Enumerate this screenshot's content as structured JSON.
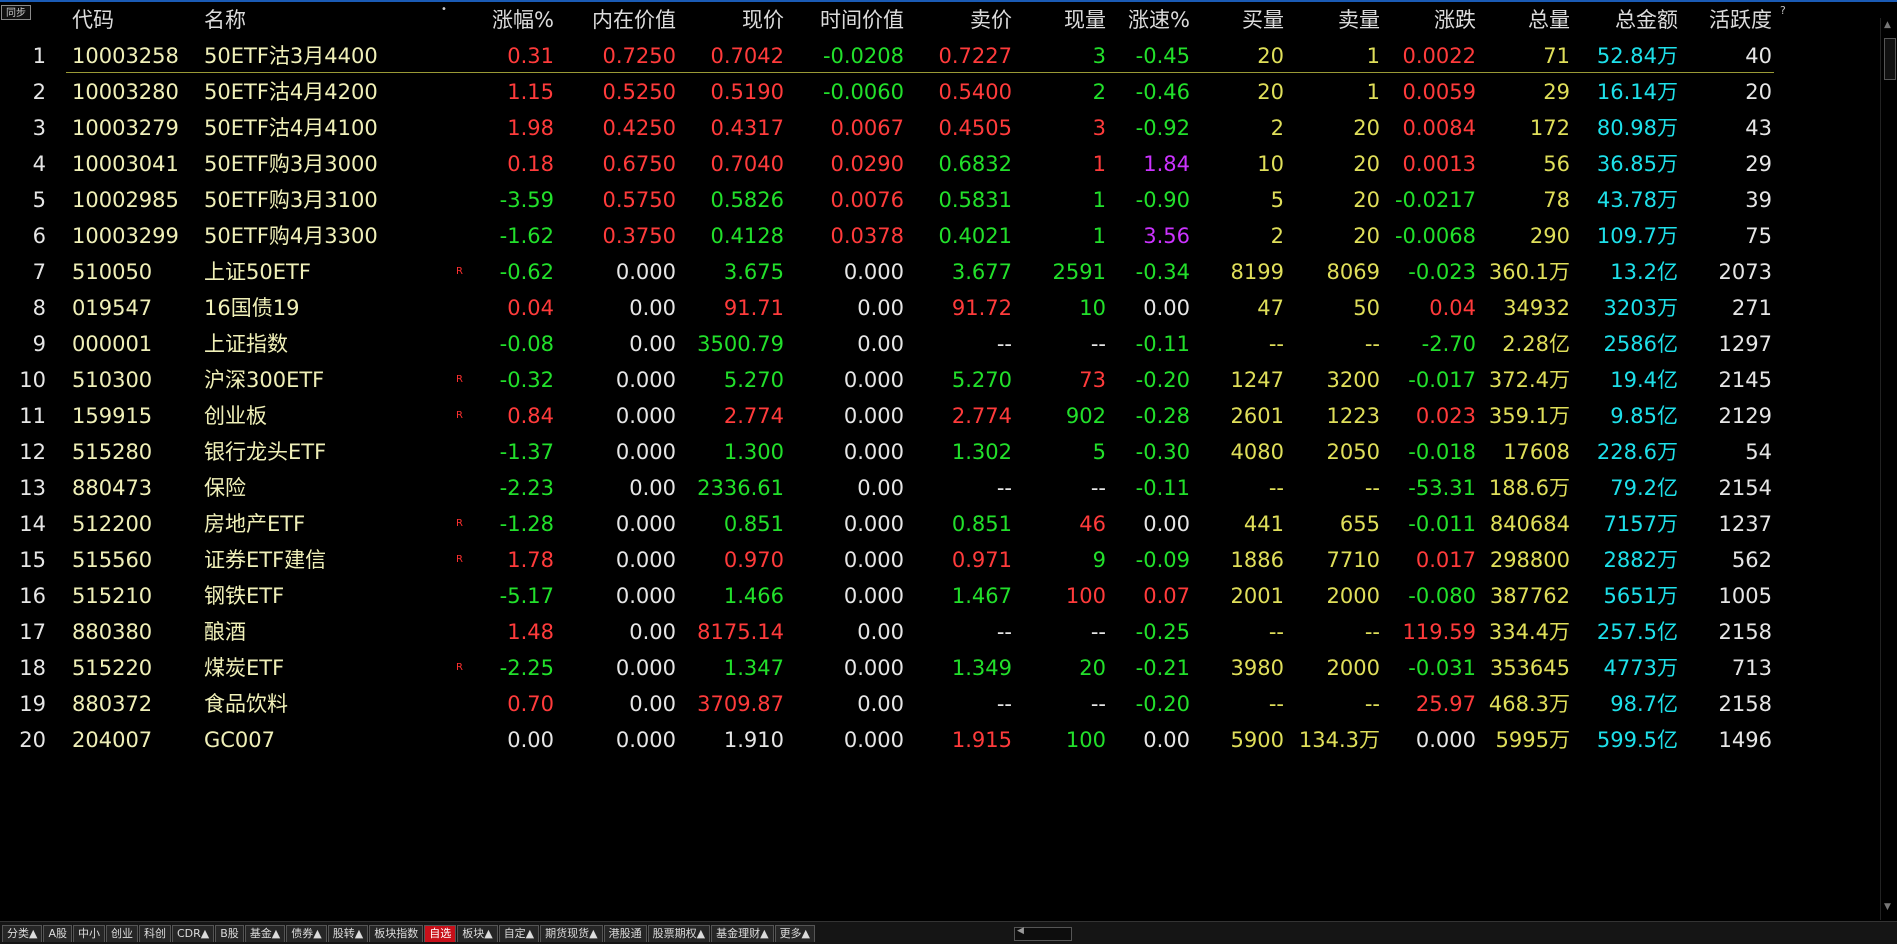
{
  "toolbar": {
    "sync_label": "同步",
    "help_mark": "?",
    "sort_indicator": "•"
  },
  "columns": {
    "idx": "",
    "code": "代码",
    "name": "名称",
    "pct": "涨幅%",
    "intrinsic": "内在价值",
    "price": "现价",
    "timeval": "时间价值",
    "ask": "卖价",
    "vol": "现量",
    "speed": "涨速%",
    "bidvol": "买量",
    "askvol": "卖量",
    "change": "涨跌",
    "total": "总量",
    "amount": "总金额",
    "activity": "活跃度"
  },
  "rows": [
    {
      "idx": "1",
      "code": "10003258",
      "name": "50ETF沽3月4400",
      "flag": "",
      "pct": "0.31",
      "intrinsic": "0.7250",
      "price": "0.7042",
      "timeval": "-0.0208",
      "ask": "0.7227",
      "vol": "3",
      "speed": "-0.45",
      "bidvol": "20",
      "askvol": "1",
      "change": "0.0022",
      "total": "71",
      "amount": "52.84万",
      "activity": "40",
      "colors": {
        "pct": "red",
        "intrinsic": "red",
        "price": "red",
        "timeval": "green",
        "ask": "red",
        "vol": "green",
        "speed": "green",
        "change": "red"
      }
    },
    {
      "idx": "2",
      "code": "10003280",
      "name": "50ETF沽4月4200",
      "flag": "",
      "pct": "1.15",
      "intrinsic": "0.5250",
      "price": "0.5190",
      "timeval": "-0.0060",
      "ask": "0.5400",
      "vol": "2",
      "speed": "-0.46",
      "bidvol": "20",
      "askvol": "1",
      "change": "0.0059",
      "total": "29",
      "amount": "16.14万",
      "activity": "20",
      "colors": {
        "pct": "red",
        "intrinsic": "red",
        "price": "red",
        "timeval": "green",
        "ask": "red",
        "vol": "green",
        "speed": "green",
        "change": "red"
      }
    },
    {
      "idx": "3",
      "code": "10003279",
      "name": "50ETF沽4月4100",
      "flag": "",
      "pct": "1.98",
      "intrinsic": "0.4250",
      "price": "0.4317",
      "timeval": "0.0067",
      "ask": "0.4505",
      "vol": "3",
      "speed": "-0.92",
      "bidvol": "2",
      "askvol": "20",
      "change": "0.0084",
      "total": "172",
      "amount": "80.98万",
      "activity": "43",
      "colors": {
        "pct": "red",
        "intrinsic": "red",
        "price": "red",
        "timeval": "red",
        "ask": "red",
        "vol": "red",
        "speed": "green",
        "change": "red"
      }
    },
    {
      "idx": "4",
      "code": "10003041",
      "name": "50ETF购3月3000",
      "flag": "",
      "pct": "0.18",
      "intrinsic": "0.6750",
      "price": "0.7040",
      "timeval": "0.0290",
      "ask": "0.6832",
      "vol": "1",
      "speed": "1.84",
      "bidvol": "10",
      "askvol": "20",
      "change": "0.0013",
      "total": "56",
      "amount": "36.85万",
      "activity": "29",
      "colors": {
        "pct": "red",
        "intrinsic": "red",
        "price": "red",
        "timeval": "red",
        "ask": "green",
        "vol": "red",
        "speed": "purple",
        "change": "red"
      }
    },
    {
      "idx": "5",
      "code": "10002985",
      "name": "50ETF购3月3100",
      "flag": "",
      "pct": "-3.59",
      "intrinsic": "0.5750",
      "price": "0.5826",
      "timeval": "0.0076",
      "ask": "0.5831",
      "vol": "1",
      "speed": "-0.90",
      "bidvol": "5",
      "askvol": "20",
      "change": "-0.0217",
      "total": "78",
      "amount": "43.78万",
      "activity": "39",
      "colors": {
        "pct": "green",
        "intrinsic": "red",
        "price": "green",
        "timeval": "red",
        "ask": "green",
        "vol": "green",
        "speed": "green",
        "change": "green"
      }
    },
    {
      "idx": "6",
      "code": "10003299",
      "name": "50ETF购4月3300",
      "flag": "",
      "pct": "-1.62",
      "intrinsic": "0.3750",
      "price": "0.4128",
      "timeval": "0.0378",
      "ask": "0.4021",
      "vol": "1",
      "speed": "3.56",
      "bidvol": "2",
      "askvol": "20",
      "change": "-0.0068",
      "total": "290",
      "amount": "109.7万",
      "activity": "75",
      "colors": {
        "pct": "green",
        "intrinsic": "red",
        "price": "green",
        "timeval": "red",
        "ask": "green",
        "vol": "green",
        "speed": "purple",
        "change": "green"
      }
    },
    {
      "idx": "7",
      "code": "510050",
      "name": "上证50ETF",
      "flag": "R",
      "pct": "-0.62",
      "intrinsic": "0.000",
      "price": "3.675",
      "timeval": "0.000",
      "ask": "3.677",
      "vol": "2591",
      "speed": "-0.34",
      "bidvol": "8199",
      "askvol": "8069",
      "change": "-0.023",
      "total": "360.1万",
      "amount": "13.2亿",
      "activity": "2073",
      "colors": {
        "pct": "green",
        "intrinsic": "white",
        "price": "green",
        "timeval": "white",
        "ask": "green",
        "vol": "green",
        "speed": "green",
        "change": "green"
      }
    },
    {
      "idx": "8",
      "code": "019547",
      "name": "16国债19",
      "flag": "",
      "pct": "0.04",
      "intrinsic": "0.00",
      "price": "91.71",
      "timeval": "0.00",
      "ask": "91.72",
      "vol": "10",
      "speed": "0.00",
      "bidvol": "47",
      "askvol": "50",
      "change": "0.04",
      "total": "34932",
      "amount": "3203万",
      "activity": "271",
      "colors": {
        "pct": "red",
        "intrinsic": "white",
        "price": "red",
        "timeval": "white",
        "ask": "red",
        "vol": "green",
        "speed": "white",
        "change": "red"
      }
    },
    {
      "idx": "9",
      "code": "000001",
      "name": "上证指数",
      "flag": "",
      "pct": "-0.08",
      "intrinsic": "0.00",
      "price": "3500.79",
      "timeval": "0.00",
      "ask": "--",
      "vol": "--",
      "speed": "-0.11",
      "bidvol": "--",
      "askvol": "--",
      "change": "-2.70",
      "total": "2.28亿",
      "amount": "2586亿",
      "activity": "1297",
      "colors": {
        "pct": "green",
        "intrinsic": "white",
        "price": "green",
        "timeval": "white",
        "ask": "white",
        "vol": "white",
        "speed": "green",
        "change": "green"
      }
    },
    {
      "idx": "10",
      "code": "510300",
      "name": "沪深300ETF",
      "flag": "R",
      "pct": "-0.32",
      "intrinsic": "0.000",
      "price": "5.270",
      "timeval": "0.000",
      "ask": "5.270",
      "vol": "73",
      "speed": "-0.20",
      "bidvol": "1247",
      "askvol": "3200",
      "change": "-0.017",
      "total": "372.4万",
      "amount": "19.4亿",
      "activity": "2145",
      "colors": {
        "pct": "green",
        "intrinsic": "white",
        "price": "green",
        "timeval": "white",
        "ask": "green",
        "vol": "red",
        "speed": "green",
        "change": "green"
      }
    },
    {
      "idx": "11",
      "code": "159915",
      "name": "创业板",
      "flag": "R",
      "pct": "0.84",
      "intrinsic": "0.000",
      "price": "2.774",
      "timeval": "0.000",
      "ask": "2.774",
      "vol": "902",
      "speed": "-0.28",
      "bidvol": "2601",
      "askvol": "1223",
      "change": "0.023",
      "total": "359.1万",
      "amount": "9.85亿",
      "activity": "2129",
      "colors": {
        "pct": "red",
        "intrinsic": "white",
        "price": "red",
        "timeval": "white",
        "ask": "red",
        "vol": "green",
        "speed": "green",
        "change": "red"
      }
    },
    {
      "idx": "12",
      "code": "515280",
      "name": "银行龙头ETF",
      "flag": "",
      "pct": "-1.37",
      "intrinsic": "0.000",
      "price": "1.300",
      "timeval": "0.000",
      "ask": "1.302",
      "vol": "5",
      "speed": "-0.30",
      "bidvol": "4080",
      "askvol": "2050",
      "change": "-0.018",
      "total": "17608",
      "amount": "228.6万",
      "activity": "54",
      "colors": {
        "pct": "green",
        "intrinsic": "white",
        "price": "green",
        "timeval": "white",
        "ask": "green",
        "vol": "green",
        "speed": "green",
        "change": "green"
      }
    },
    {
      "idx": "13",
      "code": "880473",
      "name": "保险",
      "flag": "",
      "pct": "-2.23",
      "intrinsic": "0.00",
      "price": "2336.61",
      "timeval": "0.00",
      "ask": "--",
      "vol": "--",
      "speed": "-0.11",
      "bidvol": "--",
      "askvol": "--",
      "change": "-53.31",
      "total": "188.6万",
      "amount": "79.2亿",
      "activity": "2154",
      "colors": {
        "pct": "green",
        "intrinsic": "white",
        "price": "green",
        "timeval": "white",
        "ask": "white",
        "vol": "white",
        "speed": "green",
        "change": "green"
      }
    },
    {
      "idx": "14",
      "code": "512200",
      "name": "房地产ETF",
      "flag": "R",
      "pct": "-1.28",
      "intrinsic": "0.000",
      "price": "0.851",
      "timeval": "0.000",
      "ask": "0.851",
      "vol": "46",
      "speed": "0.00",
      "bidvol": "441",
      "askvol": "655",
      "change": "-0.011",
      "total": "840684",
      "amount": "7157万",
      "activity": "1237",
      "colors": {
        "pct": "green",
        "intrinsic": "white",
        "price": "green",
        "timeval": "white",
        "ask": "green",
        "vol": "red",
        "speed": "white",
        "change": "green"
      }
    },
    {
      "idx": "15",
      "code": "515560",
      "name": "证券ETF建信",
      "flag": "R",
      "pct": "1.78",
      "intrinsic": "0.000",
      "price": "0.970",
      "timeval": "0.000",
      "ask": "0.971",
      "vol": "9",
      "speed": "-0.09",
      "bidvol": "1886",
      "askvol": "7710",
      "change": "0.017",
      "total": "298800",
      "amount": "2882万",
      "activity": "562",
      "colors": {
        "pct": "red",
        "intrinsic": "white",
        "price": "red",
        "timeval": "white",
        "ask": "red",
        "vol": "green",
        "speed": "green",
        "change": "red"
      }
    },
    {
      "idx": "16",
      "code": "515210",
      "name": "钢铁ETF",
      "flag": "",
      "pct": "-5.17",
      "intrinsic": "0.000",
      "price": "1.466",
      "timeval": "0.000",
      "ask": "1.467",
      "vol": "100",
      "speed": "0.07",
      "bidvol": "2001",
      "askvol": "2000",
      "change": "-0.080",
      "total": "387762",
      "amount": "5651万",
      "activity": "1005",
      "colors": {
        "pct": "green",
        "intrinsic": "white",
        "price": "green",
        "timeval": "white",
        "ask": "green",
        "vol": "red",
        "speed": "red",
        "change": "green"
      }
    },
    {
      "idx": "17",
      "code": "880380",
      "name": "酿酒",
      "flag": "",
      "pct": "1.48",
      "intrinsic": "0.00",
      "price": "8175.14",
      "timeval": "0.00",
      "ask": "--",
      "vol": "--",
      "speed": "-0.25",
      "bidvol": "--",
      "askvol": "--",
      "change": "119.59",
      "total": "334.4万",
      "amount": "257.5亿",
      "activity": "2158",
      "colors": {
        "pct": "red",
        "intrinsic": "white",
        "price": "red",
        "timeval": "white",
        "ask": "white",
        "vol": "white",
        "speed": "green",
        "change": "red"
      }
    },
    {
      "idx": "18",
      "code": "515220",
      "name": "煤炭ETF",
      "flag": "R",
      "pct": "-2.25",
      "intrinsic": "0.000",
      "price": "1.347",
      "timeval": "0.000",
      "ask": "1.349",
      "vol": "20",
      "speed": "-0.21",
      "bidvol": "3980",
      "askvol": "2000",
      "change": "-0.031",
      "total": "353645",
      "amount": "4773万",
      "activity": "713",
      "colors": {
        "pct": "green",
        "intrinsic": "white",
        "price": "green",
        "timeval": "white",
        "ask": "green",
        "vol": "green",
        "speed": "green",
        "change": "green"
      }
    },
    {
      "idx": "19",
      "code": "880372",
      "name": "食品饮料",
      "flag": "",
      "pct": "0.70",
      "intrinsic": "0.00",
      "price": "3709.87",
      "timeval": "0.00",
      "ask": "--",
      "vol": "--",
      "speed": "-0.20",
      "bidvol": "--",
      "askvol": "--",
      "change": "25.97",
      "total": "468.3万",
      "amount": "98.7亿",
      "activity": "2158",
      "colors": {
        "pct": "red",
        "intrinsic": "white",
        "price": "red",
        "timeval": "white",
        "ask": "white",
        "vol": "white",
        "speed": "green",
        "change": "red"
      }
    },
    {
      "idx": "20",
      "code": "204007",
      "name": "GC007",
      "flag": "",
      "pct": "0.00",
      "intrinsic": "0.000",
      "price": "1.910",
      "timeval": "0.000",
      "ask": "1.915",
      "vol": "100",
      "speed": "0.00",
      "bidvol": "5900",
      "askvol": "134.3万",
      "change": "0.000",
      "total": "5995万",
      "amount": "599.5亿",
      "activity": "1496",
      "colors": {
        "pct": "white",
        "intrinsic": "white",
        "price": "white",
        "timeval": "white",
        "ask": "red",
        "vol": "green",
        "speed": "white",
        "change": "white"
      }
    }
  ],
  "tabs": [
    {
      "label": "分类▲",
      "active": false
    },
    {
      "label": "A股",
      "active": false
    },
    {
      "label": "中小",
      "active": false
    },
    {
      "label": "创业",
      "active": false
    },
    {
      "label": "科创",
      "active": false
    },
    {
      "label": "CDR▲",
      "active": false
    },
    {
      "label": "B股",
      "active": false
    },
    {
      "label": "基金▲",
      "active": false
    },
    {
      "label": "债券▲",
      "active": false
    },
    {
      "label": "股转▲",
      "active": false
    },
    {
      "label": "板块指数",
      "active": false
    },
    {
      "label": "自选",
      "active": true
    },
    {
      "label": "板块▲",
      "active": false
    },
    {
      "label": "自定▲",
      "active": false
    },
    {
      "label": "期货现货▲",
      "active": false
    },
    {
      "label": "港股通",
      "active": false
    },
    {
      "label": "股票期权▲",
      "active": false
    },
    {
      "label": "基金理财▲",
      "active": false
    },
    {
      "label": "更多▲",
      "active": false
    }
  ],
  "colors": {
    "red": "#ff3b3b",
    "green": "#22e02b",
    "white": "#e6e6e6",
    "yellow": "#e0df5a",
    "cyan": "#1ee0ea",
    "purple": "#cc33ff",
    "active_tab": "#c8101a",
    "background": "#000000"
  },
  "icons": {
    "scroll_up": "up-arrow-icon",
    "scroll_down": "down-arrow-icon",
    "scroll_left": "left-arrow-icon"
  }
}
